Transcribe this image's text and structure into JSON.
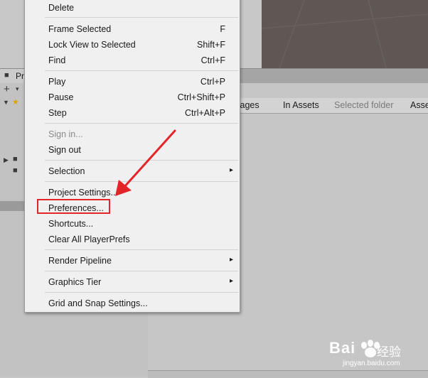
{
  "scene": {
    "background": "#5e5753"
  },
  "left_panel": {
    "header_label": "Pr",
    "add_symbol": "+",
    "dropdown_symbol": "▾"
  },
  "filter_bar": {
    "tabs": [
      {
        "label": "ckages"
      },
      {
        "label": "In Assets"
      },
      {
        "label": "Selected folder"
      },
      {
        "label": "Asse"
      }
    ]
  },
  "menu": {
    "items": [
      {
        "label": "Delete",
        "shortcut": "",
        "submenu": false,
        "disabled": false
      },
      {
        "label": "Frame Selected",
        "shortcut": "F",
        "submenu": false,
        "disabled": false
      },
      {
        "label": "Lock View to Selected",
        "shortcut": "Shift+F",
        "submenu": false,
        "disabled": false
      },
      {
        "label": "Find",
        "shortcut": "Ctrl+F",
        "submenu": false,
        "disabled": false
      },
      {
        "label": "Play",
        "shortcut": "Ctrl+P",
        "submenu": false,
        "disabled": false
      },
      {
        "label": "Pause",
        "shortcut": "Ctrl+Shift+P",
        "submenu": false,
        "disabled": false
      },
      {
        "label": "Step",
        "shortcut": "Ctrl+Alt+P",
        "submenu": false,
        "disabled": false
      },
      {
        "label": "Sign in...",
        "shortcut": "",
        "submenu": false,
        "disabled": true
      },
      {
        "label": "Sign out",
        "shortcut": "",
        "submenu": false,
        "disabled": false
      },
      {
        "label": "Selection",
        "shortcut": "",
        "submenu": true,
        "disabled": false
      },
      {
        "label": "Project Settings...",
        "shortcut": "",
        "submenu": false,
        "disabled": false
      },
      {
        "label": "Preferences...",
        "shortcut": "",
        "submenu": false,
        "disabled": false
      },
      {
        "label": "Shortcuts...",
        "shortcut": "",
        "submenu": false,
        "disabled": false
      },
      {
        "label": "Clear All PlayerPrefs",
        "shortcut": "",
        "submenu": false,
        "disabled": false
      },
      {
        "label": "Render Pipeline",
        "shortcut": "",
        "submenu": true,
        "disabled": false
      },
      {
        "label": "Graphics Tier",
        "shortcut": "",
        "submenu": true,
        "disabled": false
      },
      {
        "label": "Grid and Snap Settings...",
        "shortcut": "",
        "submenu": false,
        "disabled": false
      }
    ],
    "submenu_arrow": "▸"
  },
  "annotation": {
    "color": "#e3252a",
    "target": "Preferences..."
  },
  "watermark": {
    "brand": "Bai  ",
    "cn": "经验",
    "url": "jingyan.baidu.com"
  }
}
